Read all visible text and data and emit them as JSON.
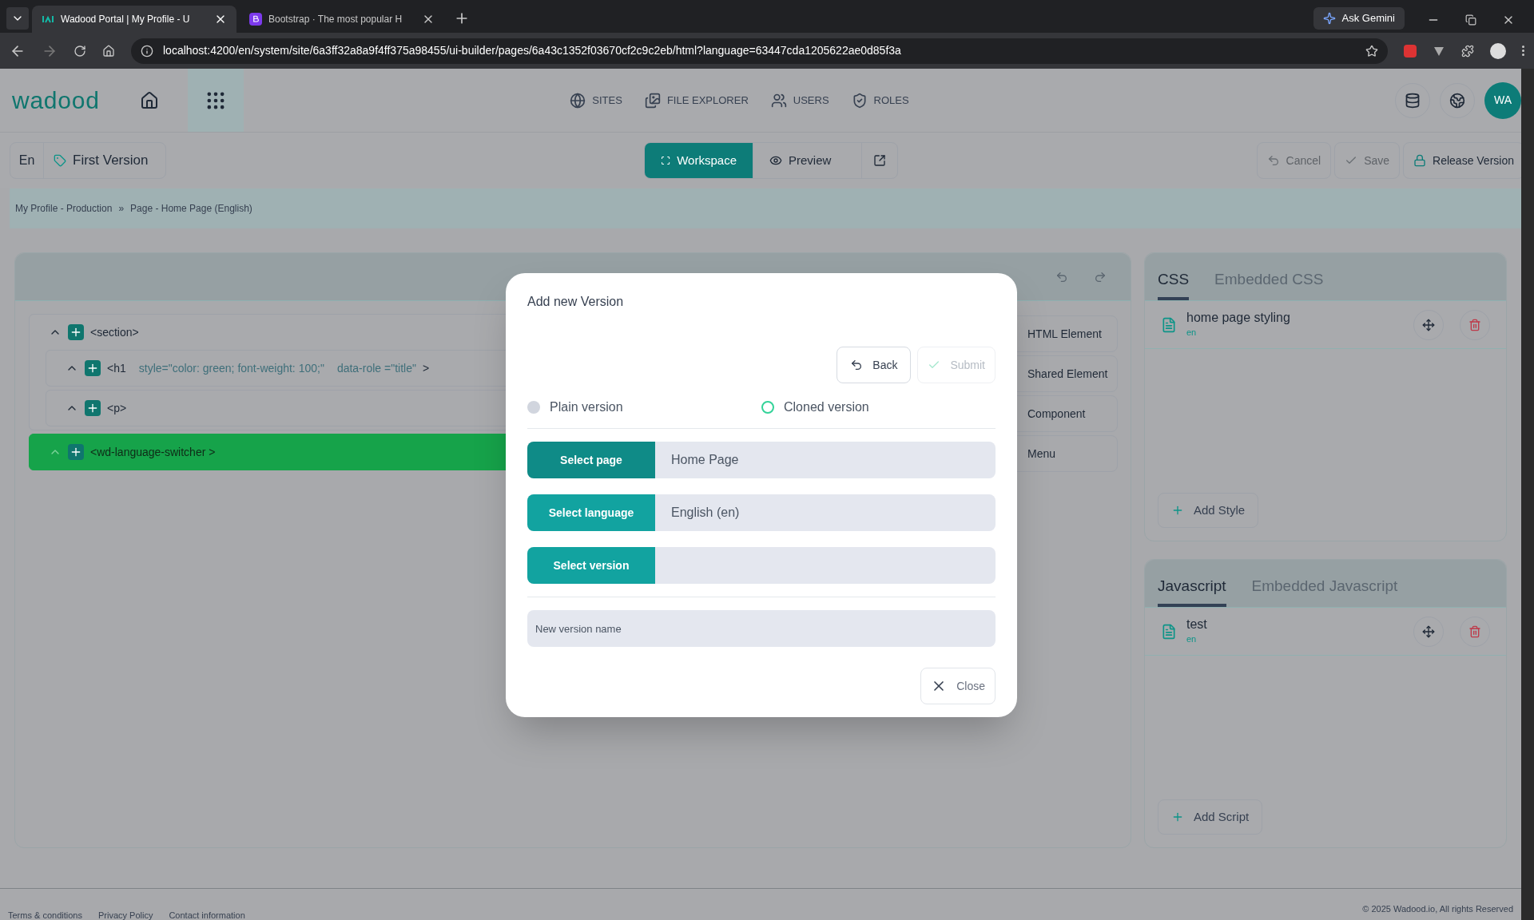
{
  "browser": {
    "tabs": [
      {
        "title": "Wadood Portal | My Profile - U",
        "kind": "wadood",
        "selected": true
      },
      {
        "title": "Bootstrap · The most popular H",
        "kind": "bootstrap",
        "selected": false
      }
    ],
    "address": "localhost:4200/en/system/site/6a3ff32a8a9f4ff375a98455/ui-builder/pages/6a43c1352f03670cf2c9c2eb/html?language=63447cda1205622ae0d85f3a",
    "assistant": "Ask Gemini"
  },
  "app_header": {
    "logo": "wadood",
    "nav": [
      {
        "label": "SITES",
        "kind": "globe"
      },
      {
        "label": "FILE EXPLORER",
        "kind": "files"
      },
      {
        "label": "USERS",
        "kind": "users"
      },
      {
        "label": "ROLES",
        "kind": "shield"
      }
    ],
    "avatar": "WA"
  },
  "toolbar": {
    "language": "En",
    "version": "First Version",
    "views": [
      {
        "label": "Workspace",
        "kind": "workspace",
        "selected": true
      },
      {
        "label": "Preview",
        "kind": "preview",
        "selected": false
      }
    ],
    "actions": [
      {
        "label": "Cancel",
        "kind": "undo",
        "disabled": true
      },
      {
        "label": "Save",
        "kind": "check",
        "disabled": true
      },
      {
        "label": "Release Version",
        "kind": "lock",
        "disabled": false
      }
    ]
  },
  "breadcrumb": {
    "items": [
      "My Profile - Production",
      "Page - Home Page (English)"
    ],
    "separator": "»"
  },
  "tree": [
    {
      "tag": "<section>",
      "selected": false,
      "children": [
        {
          "tag": "<h1",
          "attributes": [
            "style=\"color: green; font-weight: 100;\"",
            "data-role =\"title\""
          ],
          "close": ">",
          "selected": false
        },
        {
          "tag": "<p>",
          "selected": false
        }
      ]
    },
    {
      "tag": "<wd-language-switcher >",
      "selected": true
    }
  ],
  "insert_buttons": [
    "HTML Element",
    "Shared Element",
    "Component",
    "Menu"
  ],
  "css_panel": {
    "tabs": [
      {
        "label": "CSS",
        "selected": true
      },
      {
        "label": "Embedded CSS",
        "selected": false
      }
    ],
    "files": [
      {
        "name": "home page styling",
        "language": "en"
      }
    ],
    "add": "Add Style"
  },
  "js_panel": {
    "tabs": [
      {
        "label": "Javascript",
        "selected": true
      },
      {
        "label": "Embedded Javascript",
        "selected": false
      }
    ],
    "files": [
      {
        "name": "test",
        "language": "en"
      }
    ],
    "add": "Add Script"
  },
  "modal": {
    "title": "Add new Version",
    "back": "Back",
    "submit": {
      "label": "Submit",
      "disabled": true
    },
    "options": [
      {
        "label": "Plain version",
        "selected": false
      },
      {
        "label": "Cloned version",
        "selected": true
      }
    ],
    "selectors": [
      {
        "button": "Select page",
        "value": "Home Page",
        "hovered": true
      },
      {
        "button": "Select language",
        "value": "English (en)",
        "hovered": false
      },
      {
        "button": "Select version",
        "hovered": false
      }
    ],
    "name_placeholder": "New version name",
    "close": "Close"
  },
  "footer": {
    "links": [
      "Terms & conditions",
      "Privacy Policy",
      "Contact information"
    ],
    "copyright": "© 2025 Wadood.io, All rights Reserved"
  }
}
